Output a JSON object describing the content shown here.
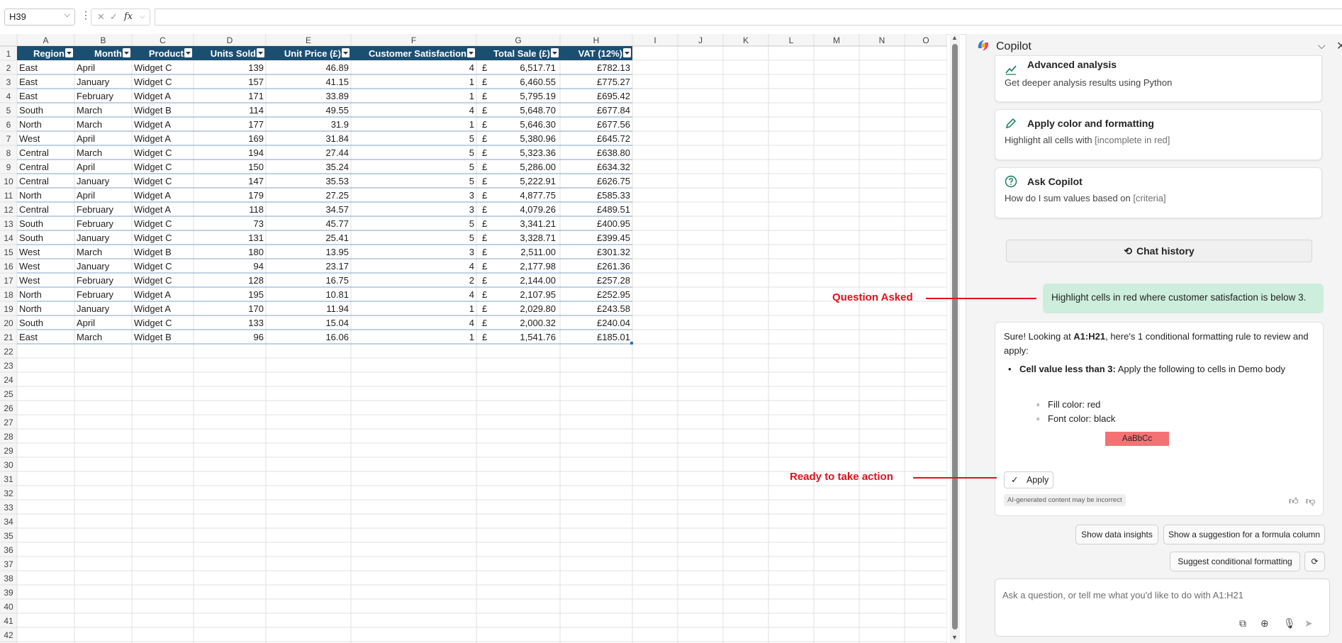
{
  "formula_bar": {
    "name_box": "H39",
    "fx_label": "fx",
    "formula": ""
  },
  "sheet": {
    "col_letters": [
      "A",
      "B",
      "C",
      "D",
      "E",
      "F",
      "G",
      "H",
      "I",
      "J",
      "K",
      "L",
      "M",
      "N",
      "O"
    ],
    "headers": [
      "Region",
      "Month",
      "Product",
      "Units Sold",
      "Unit Price (£)",
      "Customer Satisfaction",
      "Total Sale (£)",
      "VAT (12%)"
    ],
    "rows": [
      [
        "East",
        "April",
        "Widget C",
        "139",
        "46.89",
        "4",
        "6,517.71",
        "£782.13"
      ],
      [
        "East",
        "January",
        "Widget C",
        "157",
        "41.15",
        "1",
        "6,460.55",
        "£775.27"
      ],
      [
        "East",
        "February",
        "Widget A",
        "171",
        "33.89",
        "1",
        "5,795.19",
        "£695.42"
      ],
      [
        "South",
        "March",
        "Widget B",
        "114",
        "49.55",
        "4",
        "5,648.70",
        "£677.84"
      ],
      [
        "North",
        "March",
        "Widget A",
        "177",
        "31.9",
        "1",
        "5,646.30",
        "£677.56"
      ],
      [
        "West",
        "April",
        "Widget A",
        "169",
        "31.84",
        "5",
        "5,380.96",
        "£645.72"
      ],
      [
        "Central",
        "March",
        "Widget C",
        "194",
        "27.44",
        "5",
        "5,323.36",
        "£638.80"
      ],
      [
        "Central",
        "April",
        "Widget C",
        "150",
        "35.24",
        "5",
        "5,286.00",
        "£634.32"
      ],
      [
        "Central",
        "January",
        "Widget C",
        "147",
        "35.53",
        "5",
        "5,222.91",
        "£626.75"
      ],
      [
        "North",
        "April",
        "Widget A",
        "179",
        "27.25",
        "3",
        "4,877.75",
        "£585.33"
      ],
      [
        "Central",
        "February",
        "Widget A",
        "118",
        "34.57",
        "3",
        "4,079.26",
        "£489.51"
      ],
      [
        "South",
        "February",
        "Widget C",
        "73",
        "45.77",
        "5",
        "3,341.21",
        "£400.95"
      ],
      [
        "South",
        "January",
        "Widget C",
        "131",
        "25.41",
        "5",
        "3,328.71",
        "£399.45"
      ],
      [
        "West",
        "March",
        "Widget B",
        "180",
        "13.95",
        "3",
        "2,511.00",
        "£301.32"
      ],
      [
        "West",
        "January",
        "Widget C",
        "94",
        "23.17",
        "4",
        "2,177.98",
        "£261.36"
      ],
      [
        "West",
        "February",
        "Widget C",
        "128",
        "16.75",
        "2",
        "2,144.00",
        "£257.28"
      ],
      [
        "North",
        "February",
        "Widget A",
        "195",
        "10.81",
        "4",
        "2,107.95",
        "£252.95"
      ],
      [
        "North",
        "January",
        "Widget A",
        "170",
        "11.94",
        "1",
        "2,029.80",
        "£243.58"
      ],
      [
        "South",
        "April",
        "Widget C",
        "133",
        "15.04",
        "4",
        "2,000.32",
        "£240.04"
      ],
      [
        "East",
        "March",
        "Widget B",
        "96",
        "16.06",
        "1",
        "1,541.76",
        "£185.01"
      ]
    ],
    "currency_symbol": "£",
    "row_count": 42,
    "colors": {
      "header_fill": "#1b4f72",
      "header_text": "#ffffff",
      "grid_line": "#e1e1e1",
      "band_line": "#2e75b6"
    }
  },
  "copilot": {
    "title": "Copilot",
    "cards": [
      {
        "icon": "chart-line-icon",
        "title": "Advanced analysis",
        "desc": "Get deeper analysis results using Python",
        "placeholder": ""
      },
      {
        "icon": "pencil-icon",
        "title": "Apply color and formatting",
        "desc": "Highlight all cells with ",
        "placeholder": "[incomplete in red]"
      },
      {
        "icon": "question-icon",
        "title": "Ask Copilot",
        "desc": "How do I sum values based on ",
        "placeholder": "[criteria]"
      }
    ],
    "chat_history_label": "Chat history",
    "user_message": "Highlight cells in red where customer satisfaction is below 3.",
    "response": {
      "intro_pre": "Sure! Looking at ",
      "intro_range": "A1:H21",
      "intro_post": ", here's 1 conditional formatting rule to review and apply:",
      "bullet_title": "Cell value less than 3:",
      "bullet_text": " Apply the following to cells in Demo body",
      "sub_bullets": [
        "Fill color: red",
        "Font color: black"
      ],
      "sample_text": "AaBbCc",
      "apply_label": "Apply",
      "disclaimer": "AI-generated content may be incorrect"
    },
    "suggestions": [
      "Show data insights",
      "Show a suggestion for a formula column",
      "Suggest conditional formatting"
    ],
    "input_placeholder": "Ask a question, or tell me what you'd like to do with A1:H21",
    "accent_fill": "#f47174",
    "user_bubble_color": "#cdeedd"
  },
  "annotations": {
    "question": "Question Asked",
    "action": "Ready to take action",
    "color": "#e3111c"
  }
}
